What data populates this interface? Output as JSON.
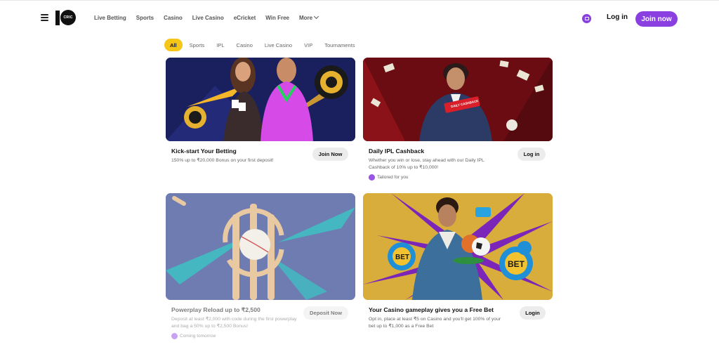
{
  "header": {
    "logo_text": "CRIC",
    "nav": [
      "Live Betting",
      "Sports",
      "Casino",
      "Live Casino",
      "eCricket",
      "Win Free",
      "More"
    ],
    "login_label": "Log in",
    "join_label": "Join now",
    "accent_color": "#8a3fe0"
  },
  "filters": {
    "items": [
      "All",
      "Sports",
      "IPL",
      "Casino",
      "Live Casino",
      "VIP",
      "Tournaments"
    ],
    "active": "All",
    "active_color": "#f5c518"
  },
  "cards": [
    {
      "title": "Kick-start Your Betting",
      "desc": "150% up to ₹20,000 Bonus on your first deposit!",
      "button": "Join Now",
      "tag": ""
    },
    {
      "title": "Daily IPL Cashback",
      "desc": "Whether you win or lose, stay ahead with our Daily IPL Cashback of 10% up to ₹10,000!",
      "button": "Log in",
      "tag": "Tailored for you",
      "banner_text": "DAILY CASHBACK"
    },
    {
      "title": "Powerplay Reload up to ₹2,500",
      "desc": "Deposit at least ₹2,000 with code during the first powerplay and bag a 50% up to ₹2,500 Bonus!",
      "button": "Deposit Now",
      "tag": "Coming tomorrow"
    },
    {
      "title": "Your Casino gameplay gives you a Free Bet",
      "desc": "Opt in, place at least ₹5 on Casino and you'll get 100% of your bet up to ₹1,000 as a Free Bet",
      "button": "Login",
      "tag": "",
      "chip_text_1": "BET",
      "chip_text_2": "BET"
    }
  ]
}
